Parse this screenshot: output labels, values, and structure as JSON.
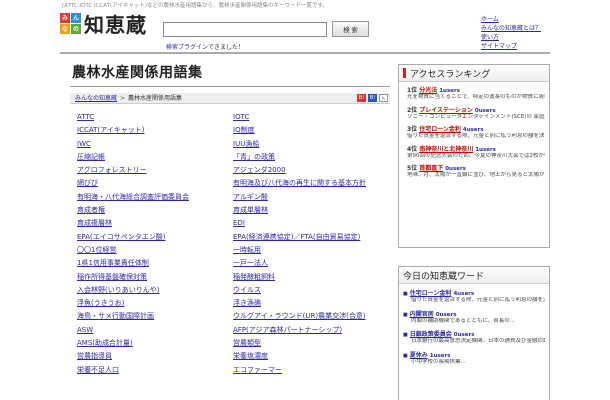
{
  "header": {
    "top_note": "[ATTC IOTC ICCAT(アイキャット)などの農林水産用語集から、農林水産関係用語集のキーワード一覧です。",
    "logo_chars": [
      "み",
      "ん",
      "な",
      "の"
    ],
    "logo_text": "知恵蔵",
    "search_value": "",
    "search_button": "検 索",
    "plugin_link": "検索プラグイン",
    "plugin_note": "できました！",
    "nav": [
      "ホーム",
      "みんなの知恵蔵とは？",
      "使い方",
      "サイトマップ"
    ]
  },
  "main": {
    "title": "農林水産関係用語集",
    "breadcrumb": {
      "home": "みんなの知恵蔵",
      "current": "農林水産関係用語集"
    },
    "icons": [
      "B!",
      "B!",
      "✎"
    ],
    "terms": [
      [
        "ATTC",
        "IOTC"
      ],
      [
        "ICCAT(アイキャット)",
        "IQ制度"
      ],
      [
        "IWC",
        "IUU漁船"
      ],
      [
        "圧縮記帳",
        "「青」の政策"
      ],
      [
        "アグロフォレストリー",
        "アジェンダ2000"
      ],
      [
        "網びび",
        "有明海及び八代海の再生に関する基本方針"
      ],
      [
        "有明海・八代海総合調査評価委員会",
        "アルギン酸"
      ],
      [
        "育成者権",
        "育成単層林"
      ],
      [
        "育成複層林",
        "EDI"
      ],
      [
        "EPA(エイコサペンタエン酸)",
        "EPA(経済連携協定)／FTA(自由貿易協定)"
      ],
      [
        "〇〇1位経営",
        "一時転用"
      ],
      [
        "1県1信用事業責任体制",
        "一戸一法人"
      ],
      [
        "稲作所得基盤確保対策",
        "稲発酵粗飼料"
      ],
      [
        "入会林野(いりあいりんや)",
        "ウイルス"
      ],
      [
        "浮魚(うきうお)",
        "浮き漁礁"
      ],
      [
        "海鳥・サメ行動国際計画",
        "ウルグアイ・ラウンド(UR)農業交渉(合意)"
      ],
      [
        "ASW",
        "AFP(アジア森林パートナーシップ)"
      ],
      [
        "AMS(助成合計量)",
        "営農類型",
        "営農類型別経営統計"
      ],
      [
        "営農指導員",
        "栄養塩濃度"
      ],
      [
        "栄養不足人口",
        "エコファーマー"
      ]
    ]
  },
  "ranking": {
    "title": "アクセスランキング",
    "items": [
      {
        "rank": "1位",
        "name": "分光法",
        "users": "1users",
        "desc": "光を物質に当てることで、特定の波長のものが物質に吸収、放出する..."
      },
      {
        "rank": "2位",
        "name": "プレイステーション",
        "users": "0users",
        "desc": "ソニー・コンピュータエンタテインメント(SCE)の 家庭用ゲーム機。1994..."
      },
      {
        "rank": "3位",
        "name": "住宅ローン金利",
        "users": "4users",
        "desc": "借りた資金を返済する際、元金と別に払う利息の額を決める率。元金..."
      },
      {
        "rank": "4位",
        "name": "南神奈川と北神奈川",
        "users": "1users",
        "desc": "第90回の記念大会のため、今夏の神奈川大会では2校が甲子園の選手権大会に出..."
      },
      {
        "rank": "5位",
        "name": "首都直下",
        "users": "0users",
        "desc": "地味、月、太陽が一直線に並び、地上から見ると太陽が月の陰に隠れる天文..."
      }
    ]
  },
  "today": {
    "title": "今日の知恵蔵ワード",
    "items": [
      {
        "name": "住宅ローン金利",
        "users": "4users",
        "desc": "借りた資金を返済する際、元金と別に払う利息の額を決める率。元金..."
      },
      {
        "name": "内閣官房",
        "users": "0users",
        "desc": "内閣の補助機関であるとともに、首長の..."
      },
      {
        "name": "日銀政策委員会",
        "users": "0users",
        "desc": "日本銀行の最高意思決定機関。日本の通貨及び金融の調節..."
      },
      {
        "name": "夏休み",
        "users": "1users",
        "desc": "小中学校の長期休業..."
      }
    ]
  }
}
